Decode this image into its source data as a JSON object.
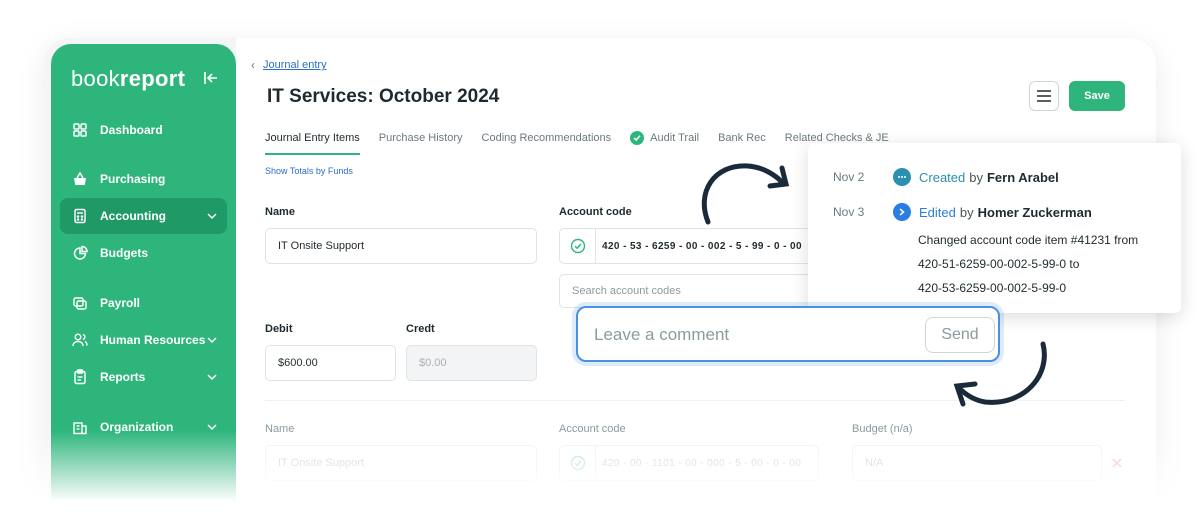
{
  "app": {
    "logo_light": "book",
    "logo_bold": "report"
  },
  "sidebar": {
    "items": [
      {
        "label": "Dashboard"
      },
      {
        "label": "Purchasing"
      },
      {
        "label": "Accounting"
      },
      {
        "label": "Budgets"
      },
      {
        "label": "Payroll"
      },
      {
        "label": "Human Resources"
      },
      {
        "label": "Reports"
      },
      {
        "label": "Organization"
      }
    ]
  },
  "breadcrumb": {
    "link": "Journal entry"
  },
  "page": {
    "title": "IT Services: October 2024"
  },
  "toolbar": {
    "save_label": "Save"
  },
  "tabs": [
    {
      "label": "Journal Entry Items"
    },
    {
      "label": "Purchase History"
    },
    {
      "label": "Coding Recommendations"
    },
    {
      "label": "Audit Trail"
    },
    {
      "label": "Bank Rec"
    },
    {
      "label": "Related Checks & JE"
    }
  ],
  "totals_link": "Show Totals by Funds",
  "form": {
    "name_label": "Name",
    "name_value": "IT Onsite Support",
    "account_label": "Account code",
    "account_value": "420 - 53 - 6259 - 00 - 002 - 5 - 99 - 0 - 00",
    "search_placeholder": "Search account codes",
    "debit_label": "Debit",
    "debit_value": "$600.00",
    "credit_label": "Credt",
    "credit_value": "$0.00"
  },
  "row2": {
    "name_label": "Name",
    "name_value": "IT Onsite Support",
    "account_label": "Account code",
    "account_value": "420 - 00 - 1101 - 00 - 000 - 5 - 00 - 0 - 00",
    "budget_label": "Budget (n/a)",
    "budget_value": "N/A"
  },
  "audit": {
    "entries": [
      {
        "date": "Nov 2",
        "action": "Created",
        "by": "by",
        "user": "Fern Arabel"
      },
      {
        "date": "Nov 3",
        "action": "Edited",
        "by": "by",
        "user": "Homer Zuckerman"
      }
    ],
    "detail_line1": "Changed  account code item #41231 from",
    "detail_line2": "420-51-6259-00-002-5-99-0 to",
    "detail_line3": "420-53-6259-00-002-5-99-0"
  },
  "comment": {
    "placeholder": "Leave a comment",
    "send_label": "Send"
  },
  "colors": {
    "brand": "#2db57c",
    "brand_dark": "#1f9966",
    "link": "#2a6fc9",
    "focus": "#4a90e2"
  }
}
